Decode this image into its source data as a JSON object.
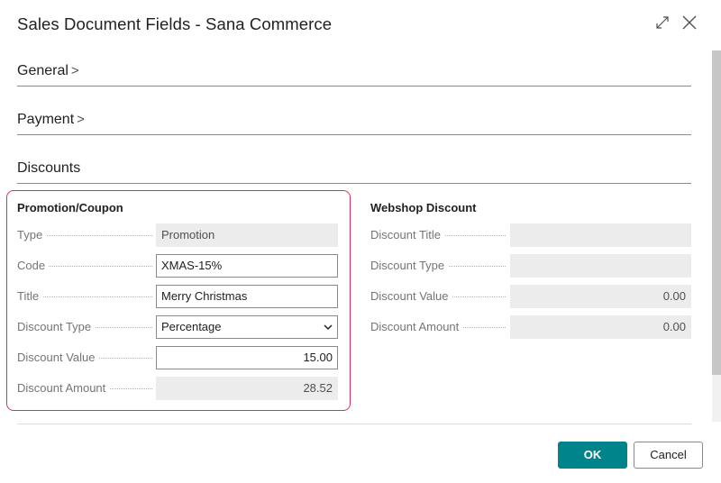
{
  "dialog": {
    "title": "Sales Document Fields - Sana Commerce",
    "expand_icon": "expand-icon",
    "close_icon": "close-icon"
  },
  "sections": {
    "general": {
      "label": "General",
      "chevron": ">"
    },
    "payment": {
      "label": "Payment",
      "chevron": ">"
    },
    "discounts": {
      "label": "Discounts"
    }
  },
  "promotion": {
    "title": "Promotion/Coupon",
    "fields": {
      "type": {
        "label": "Type",
        "value": "Promotion"
      },
      "code": {
        "label": "Code",
        "value": "XMAS-15%"
      },
      "title": {
        "label": "Title",
        "value": "Merry Christmas"
      },
      "discount_type": {
        "label": "Discount Type",
        "value": "Percentage"
      },
      "discount_value": {
        "label": "Discount Value",
        "value": "15.00"
      },
      "discount_amount": {
        "label": "Discount Amount",
        "value": "28.52"
      }
    }
  },
  "webshop": {
    "title": "Webshop Discount",
    "fields": {
      "discount_title": {
        "label": "Discount Title",
        "value": ""
      },
      "discount_type": {
        "label": "Discount Type",
        "value": ""
      },
      "discount_value": {
        "label": "Discount Value",
        "value": "0.00"
      },
      "discount_amount": {
        "label": "Discount Amount",
        "value": "0.00"
      }
    }
  },
  "buttons": {
    "ok": "OK",
    "cancel": "Cancel"
  },
  "colors": {
    "accent": "#00848c",
    "highlight_border": "#d6335a",
    "readonly_bg": "#ececec"
  }
}
